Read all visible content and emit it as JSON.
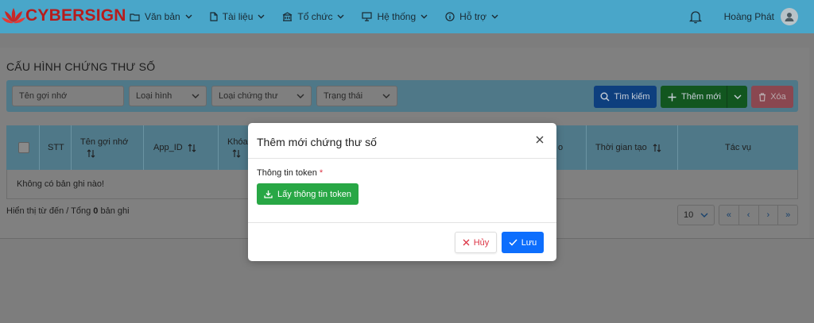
{
  "navbar": {
    "logo": {
      "part1": "CYBER",
      "part2": "SIGN"
    },
    "menu": [
      {
        "label": "Văn bản",
        "icon": "folder-icon"
      },
      {
        "label": "Tài liệu",
        "icon": "file-icon"
      },
      {
        "label": "Tổ chức",
        "icon": "building-icon"
      },
      {
        "label": "Hệ thống",
        "icon": "monitor-icon"
      },
      {
        "label": "Hỗ trợ",
        "icon": "info-icon"
      }
    ],
    "user_name": "Hoàng Phát"
  },
  "page": {
    "title": "CẤU HÌNH CHỨNG THƯ SỐ"
  },
  "filters": {
    "alias_placeholder": "Tên gợi nhớ",
    "type_label": "Loại hình",
    "cert_type_label": "Loại chứng thư",
    "status_label": "Trạng thái"
  },
  "actions": {
    "search": "Tìm kiếm",
    "add": "Thêm mới",
    "delete": "Xóa"
  },
  "table": {
    "columns": [
      "STT",
      "Tên gợi nhớ",
      "App_ID",
      "Khóa",
      "o",
      "Thời gian tạo",
      "Tác vụ"
    ],
    "empty_text": "Không có bản ghi nào!"
  },
  "footer": {
    "text_prefix": "Hiển thị từ đến / Tổng",
    "total": "0",
    "text_suffix": "bản ghi",
    "page_size": "10",
    "pager": [
      "«",
      "‹",
      "›",
      "»"
    ]
  },
  "modal": {
    "title": "Thêm mới chứng thư số",
    "field_label": "Thông tin token",
    "required_mark": "*",
    "token_button": "Lấy thông tin token",
    "cancel": "Hủy",
    "save": "Lưu"
  },
  "colors": {
    "navbar": "#49a6c9",
    "primary": "#0d6efd",
    "success": "#28a745",
    "danger": "#dc3545"
  }
}
